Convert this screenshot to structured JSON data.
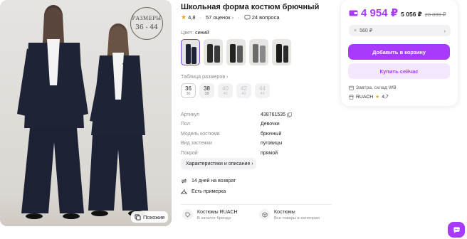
{
  "photo": {
    "badge_line1": "РАЗМЕРЫ",
    "badge_line2": "36 - 44",
    "similar_label": "Похожие"
  },
  "product": {
    "title": "Школьная форма костюм брючный",
    "rating": "4,8",
    "reviews": "57 оценок",
    "questions": "24 вопроса"
  },
  "color": {
    "label": "Цвет:",
    "value": "синий"
  },
  "size_table_link": "Таблица размеров",
  "sizes": [
    {
      "ru": "36",
      "eu": "36",
      "state": "active"
    },
    {
      "ru": "38",
      "eu": "38",
      "state": "available"
    },
    {
      "ru": "40",
      "eu": "40",
      "state": "disabled"
    },
    {
      "ru": "42",
      "eu": "42",
      "state": "disabled"
    },
    {
      "ru": "44",
      "eu": "44",
      "state": "disabled"
    }
  ],
  "specs": [
    {
      "key": "Артикул",
      "value": "438761535"
    },
    {
      "key": "Пол",
      "value": "Девочки"
    },
    {
      "key": "Модель костюма",
      "value": "брючный"
    },
    {
      "key": "Вид застежки",
      "value": "пуговицы"
    },
    {
      "key": "Покрой",
      "value": "прямой"
    }
  ],
  "characteristics_button": "Характеристики и описание",
  "perks": {
    "return": "14 дней на возврат",
    "fitting": "Есть примерка"
  },
  "brand": {
    "title": "Костюмы RUACH",
    "subtitle": "В каталог бренда"
  },
  "category": {
    "title": "Костюмы",
    "subtitle": "Все товары в категории"
  },
  "card": {
    "price_main": "4 954 ₽",
    "price_alt": "5 056 ₽",
    "price_old": "28 000 ₽",
    "installment": "560 ₽",
    "add_to_cart": "Добавить в корзину",
    "buy_now": "Купить сейчас",
    "delivery": "Завтра, склад WB",
    "seller": "RUACH",
    "seller_rating": "4,7"
  },
  "colors": {
    "accent": "#a73afd",
    "accent_light": "#f3e8ff",
    "star": "#f6a21c"
  }
}
